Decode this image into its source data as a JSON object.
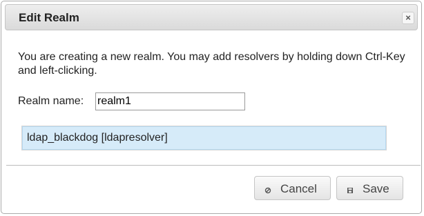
{
  "dialog": {
    "title": "Edit Realm",
    "close_icon_glyph": "×",
    "message": "You are creating a new realm. You may add resolvers by holding down Ctrl-Key and left-clicking.",
    "realm_name_label": "Realm name:",
    "realm_name_value": "realm1",
    "resolvers": [
      {
        "label": "ldap_blackdog [ldapresolver]",
        "selected": true
      }
    ],
    "buttons": {
      "cancel": {
        "label": "Cancel",
        "icon": "cancel-icon"
      },
      "save": {
        "label": "Save",
        "icon": "floppy-disk-icon"
      }
    }
  },
  "colors": {
    "selected_item_bg": "#d6ebf9",
    "titlebar_bg": "#e4e4e4"
  }
}
